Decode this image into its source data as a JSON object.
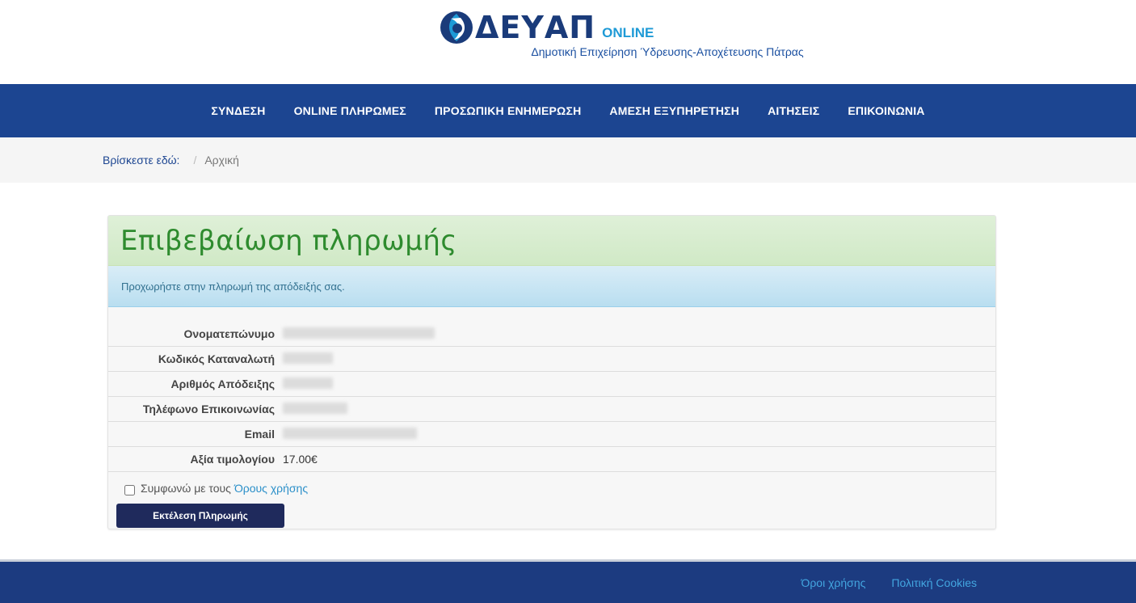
{
  "header": {
    "logo_text": "ΔΕΥΑΠ",
    "logo_online": "ONLINE",
    "tagline": "Δημοτική Επιχείρηση Ύδρευσης-Αποχέτευσης Πάτρας"
  },
  "nav": {
    "items": [
      {
        "label": "ΣΥΝΔΕΣΗ"
      },
      {
        "label": "ONLINE ΠΛΗΡΩΜΕΣ"
      },
      {
        "label": "ΠΡΟΣΩΠΙΚΗ ΕΝΗΜΕΡΩΣΗ"
      },
      {
        "label": "ΑΜΕΣΗ ΕΞΥΠΗΡΕΤΗΣΗ"
      },
      {
        "label": "ΑΙΤΗΣΕΙΣ"
      },
      {
        "label": "ΕΠΙΚΟΙΝΩΝΙΑ"
      }
    ]
  },
  "breadcrumb": {
    "label": "Βρίσκεστε εδώ:",
    "separator": "/",
    "current": "Αρχική"
  },
  "panel": {
    "title": "Επιβεβαίωση πληρωμής",
    "alert": "Προχωρήστε στην πληρωμή της απόδειξής σας.",
    "rows": [
      {
        "label": "Ονοματεπώνυμο",
        "value": ""
      },
      {
        "label": "Κωδικός Καταναλωτή",
        "value": ""
      },
      {
        "label": "Αριθμός Απόδειξης",
        "value": ""
      },
      {
        "label": "Τηλέφωνο Επικοινωνίας",
        "value": ""
      },
      {
        "label": "Email",
        "value": ""
      },
      {
        "label": "Αξία τιμολογίου",
        "value": "17.00€"
      }
    ],
    "agree_text": "Συμφωνώ με τους",
    "agree_link": "Όρους χρήσης",
    "agree_checked": false,
    "pay_button": "Εκτέλεση Πληρωμής"
  },
  "footer": {
    "links": [
      {
        "label": "Όροι χρήσης"
      },
      {
        "label": "Πολιτική Cookies"
      }
    ]
  },
  "colors": {
    "nav_bg": "#1c4591",
    "footer_bg": "#1c3b80",
    "title_green": "#2e8b2e",
    "button_bg": "#1f2a5c",
    "link_blue": "#2a8fc9"
  }
}
